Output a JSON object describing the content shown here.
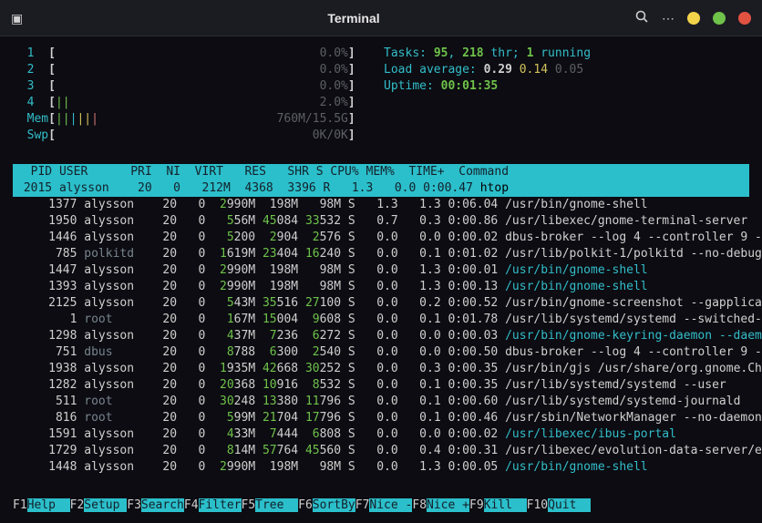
{
  "window": {
    "title": "Terminal"
  },
  "meters": {
    "cpu": [
      {
        "id": "1",
        "bar": "",
        "pct": "0.0%"
      },
      {
        "id": "2",
        "bar": "",
        "pct": "0.0%"
      },
      {
        "id": "3",
        "bar": "",
        "pct": "0.0%"
      },
      {
        "id": "4",
        "bar": "||",
        "pct": "2.0%"
      }
    ],
    "mem": {
      "label": "Mem",
      "bar": "||||||",
      "value": "760M/15.5G"
    },
    "swp": {
      "label": "Swp",
      "bar": "",
      "value": "0K/0K"
    }
  },
  "sys": {
    "tasks_label": "Tasks: ",
    "tasks_procs": "95",
    "tasks_sep": ", ",
    "tasks_thr": "218",
    "tasks_suffix": " thr; ",
    "tasks_running": "1",
    "tasks_running_suffix": " running",
    "load_label": "Load average: ",
    "load_1": "0.29",
    "load_5": "0.14",
    "load_15": "0.05",
    "uptime_label": "Uptime: ",
    "uptime": "00:01:35"
  },
  "header": {
    "pid": "  PID",
    "user": "USER     ",
    "pri": " PRI",
    "ni": "  NI",
    "virt": " VIRT",
    "res": "   RES",
    "shr": "   SHR",
    "s": "S",
    "cpu": "CPU%",
    "mem": "MEM%",
    "time": "  TIME+ ",
    "cmd": "Command"
  },
  "rows": [
    {
      "pid": " 2015",
      "user": "alysson",
      "pri": "  20",
      "ni": "   0",
      "virt": "  212M",
      "res": "  4368",
      "resHi": "",
      "shr": "  3396",
      "shrHi": "",
      "s": "R",
      "cpu": "  1.3",
      "mem": "  0.0",
      "time": " 0:00.47",
      "cmd": "htop",
      "sel": true
    },
    {
      "pid": " 1377",
      "user": "alysson",
      "pri": "  20",
      "ni": "   0",
      "virt": " 2990M",
      "virtHi": "2",
      "res": "  198M",
      "shr": "   98M",
      "s": "S",
      "cpu": "  1.3",
      "mem": "  1.3",
      "time": " 0:06.04",
      "cmd": "/usr/bin/gnome-shell"
    },
    {
      "pid": " 1950",
      "user": "alysson",
      "pri": "  20",
      "ni": "   0",
      "virt": "  556M",
      "virtHi": "5",
      "res": " 45084",
      "resHi": "45",
      "shr": " 33532",
      "shrHi": "33",
      "s": "S",
      "cpu": "  0.7",
      "mem": "  0.3",
      "time": " 0:00.86",
      "cmd": "/usr/libexec/gnome-terminal-server"
    },
    {
      "pid": " 1446",
      "user": "alysson",
      "pri": "  20",
      "ni": "   0",
      "virt": "  5200",
      "virtHi": "5",
      "res": "  2904",
      "resHi": "2",
      "shr": "  2576",
      "shrHi": "2",
      "s": "S",
      "cpu": "  0.0",
      "mem": "  0.0",
      "time": " 0:00.02",
      "cmd": "dbus-broker --log 4 --controller 9 -"
    },
    {
      "pid": "  785",
      "user": "polkitd",
      "daemon": true,
      "pri": "  20",
      "ni": "   0",
      "virt": " 1619M",
      "virtHi": "1",
      "res": " 23404",
      "resHi": "23",
      "shr": " 16240",
      "shrHi": "16",
      "s": "S",
      "cpu": "  0.0",
      "mem": "  0.1",
      "time": " 0:01.02",
      "cmd": "/usr/lib/polkit-1/polkitd --no-debug"
    },
    {
      "pid": " 1447",
      "user": "alysson",
      "pri": "  20",
      "ni": "   0",
      "virt": " 2990M",
      "virtHi": "2",
      "res": "  198M",
      "shr": "   98M",
      "s": "S",
      "cpu": "  0.0",
      "mem": "  1.3",
      "time": " 0:00.01",
      "cmd": "/usr/bin/gnome-shell",
      "faded": true
    },
    {
      "pid": " 1393",
      "user": "alysson",
      "pri": "  20",
      "ni": "   0",
      "virt": " 2990M",
      "virtHi": "2",
      "res": "  198M",
      "shr": "   98M",
      "s": "S",
      "cpu": "  0.0",
      "mem": "  1.3",
      "time": " 0:00.13",
      "cmd": "/usr/bin/gnome-shell",
      "faded": true
    },
    {
      "pid": " 2125",
      "user": "alysson",
      "pri": "  20",
      "ni": "   0",
      "virt": "  543M",
      "virtHi": "5",
      "res": " 35516",
      "resHi": "35",
      "shr": " 27100",
      "shrHi": "27",
      "s": "S",
      "cpu": "  0.0",
      "mem": "  0.2",
      "time": " 0:00.52",
      "cmd": "/usr/bin/gnome-screenshot --gapplica"
    },
    {
      "pid": "    1",
      "user": "root",
      "daemon": true,
      "pri": "  20",
      "ni": "   0",
      "virt": "  167M",
      "virtHi": "1",
      "res": " 15004",
      "resHi": "15",
      "shr": "  9608",
      "shrHi": "9",
      "s": "S",
      "cpu": "  0.0",
      "mem": "  0.1",
      "time": " 0:01.78",
      "cmd": "/usr/lib/systemd/systemd --switched-"
    },
    {
      "pid": " 1298",
      "user": "alysson",
      "pri": "  20",
      "ni": "   0",
      "virt": "  437M",
      "virtHi": "4",
      "res": "  7236",
      "resHi": "7",
      "shr": "  6272",
      "shrHi": "6",
      "s": "S",
      "cpu": "  0.0",
      "mem": "  0.0",
      "time": " 0:00.03",
      "cmd": "/usr/bin/gnome-keyring-daemon --daem",
      "faded": true
    },
    {
      "pid": "  751",
      "user": "dbus",
      "daemon": true,
      "pri": "  20",
      "ni": "   0",
      "virt": "  8788",
      "virtHi": "8",
      "res": "  6300",
      "resHi": "6",
      "shr": "  2540",
      "shrHi": "2",
      "s": "S",
      "cpu": "  0.0",
      "mem": "  0.0",
      "time": " 0:00.50",
      "cmd": "dbus-broker --log 4 --controller 9 -"
    },
    {
      "pid": " 1938",
      "user": "alysson",
      "pri": "  20",
      "ni": "   0",
      "virt": " 1935M",
      "virtHi": "1",
      "res": " 42668",
      "resHi": "42",
      "shr": " 30252",
      "shrHi": "30",
      "s": "S",
      "cpu": "  0.0",
      "mem": "  0.3",
      "time": " 0:00.35",
      "cmd": "/usr/bin/gjs /usr/share/org.gnome.Ch"
    },
    {
      "pid": " 1282",
      "user": "alysson",
      "pri": "  20",
      "ni": "   0",
      "virt": " 20368",
      "virtHi": "20",
      "res": " 10916",
      "resHi": "10",
      "shr": "  8532",
      "shrHi": "8",
      "s": "S",
      "cpu": "  0.0",
      "mem": "  0.1",
      "time": " 0:00.35",
      "cmd": "/usr/lib/systemd/systemd --user"
    },
    {
      "pid": "  511",
      "user": "root",
      "daemon": true,
      "pri": "  20",
      "ni": "   0",
      "virt": " 30248",
      "virtHi": "30",
      "res": " 13380",
      "resHi": "13",
      "shr": " 11796",
      "shrHi": "11",
      "s": "S",
      "cpu": "  0.0",
      "mem": "  0.1",
      "time": " 0:00.60",
      "cmd": "/usr/lib/systemd/systemd-journald"
    },
    {
      "pid": "  816",
      "user": "root",
      "daemon": true,
      "pri": "  20",
      "ni": "   0",
      "virt": "  599M",
      "virtHi": "5",
      "res": " 21704",
      "resHi": "21",
      "shr": " 17796",
      "shrHi": "17",
      "s": "S",
      "cpu": "  0.0",
      "mem": "  0.1",
      "time": " 0:00.46",
      "cmd": "/usr/sbin/NetworkManager --no-daemon"
    },
    {
      "pid": " 1591",
      "user": "alysson",
      "pri": "  20",
      "ni": "   0",
      "virt": "  433M",
      "virtHi": "4",
      "res": "  7444",
      "resHi": "7",
      "shr": "  6808",
      "shrHi": "6",
      "s": "S",
      "cpu": "  0.0",
      "mem": "  0.0",
      "time": " 0:00.02",
      "cmd": "/usr/libexec/ibus-portal",
      "faded": true
    },
    {
      "pid": " 1729",
      "user": "alysson",
      "pri": "  20",
      "ni": "   0",
      "virt": "  814M",
      "virtHi": "8",
      "res": " 57764",
      "resHi": "57",
      "shr": " 45560",
      "shrHi": "45",
      "s": "S",
      "cpu": "  0.0",
      "mem": "  0.4",
      "time": " 0:00.31",
      "cmd": "/usr/libexec/evolution-data-server/e"
    },
    {
      "pid": " 1448",
      "user": "alysson",
      "pri": "  20",
      "ni": "   0",
      "virt": " 2990M",
      "virtHi": "2",
      "res": "  198M",
      "shr": "   98M",
      "s": "S",
      "cpu": "  0.0",
      "mem": "  1.3",
      "time": " 0:00.05",
      "cmd": "/usr/bin/gnome-shell",
      "faded": true
    }
  ],
  "fkeys": [
    {
      "key": "F1",
      "label": "Help  "
    },
    {
      "key": "F2",
      "label": "Setup "
    },
    {
      "key": "F3",
      "label": "Search"
    },
    {
      "key": "F4",
      "label": "Filter"
    },
    {
      "key": "F5",
      "label": "Tree  "
    },
    {
      "key": "F6",
      "label": "SortBy"
    },
    {
      "key": "F7",
      "label": "Nice -"
    },
    {
      "key": "F8",
      "label": "Nice +"
    },
    {
      "key": "F9",
      "label": "Kill  "
    },
    {
      "key": "F10",
      "label": "Quit  "
    }
  ]
}
